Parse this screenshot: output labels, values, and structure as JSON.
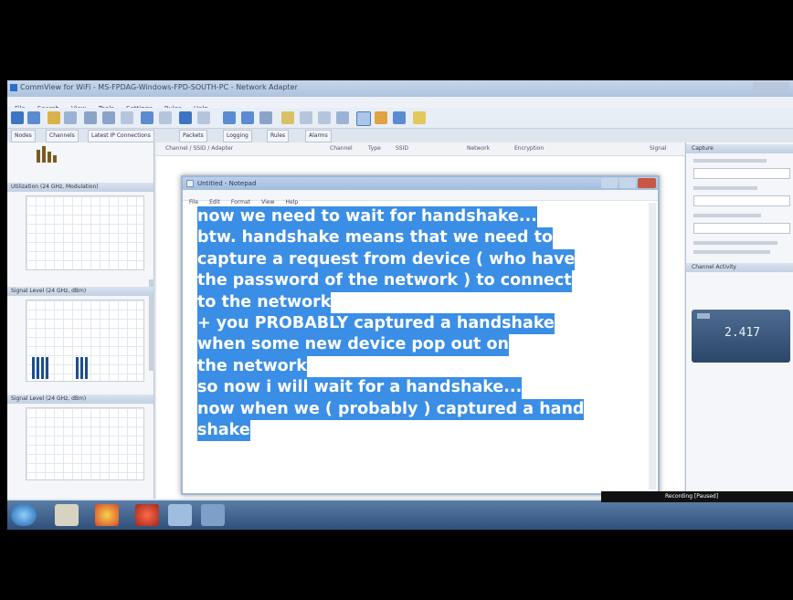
{
  "window": {
    "title": "CommView for WiFi - MS-FPDAG-Windows-FPD-SOUTH-PC - Network Adapter"
  },
  "menu": [
    "File",
    "Search",
    "View",
    "Tools",
    "Settings",
    "Rules",
    "Help"
  ],
  "tabs": [
    "Nodes",
    "Channels",
    "Latest IP Connections",
    "Packets",
    "Logging",
    "Rules",
    "Alarms"
  ],
  "left_panels": [
    {
      "title": "Utilization (24 GHz, Modulation)"
    },
    {
      "title": "Signal Level (24 GHz, dBm)"
    },
    {
      "title": "Signal Level (24 GHz, dBm)"
    }
  ],
  "main_columns": [
    "Channel / SSID / Adapter",
    "Channel",
    "Type",
    "SSID",
    "Network",
    "Encryption",
    "Signal"
  ],
  "right_panel": {
    "capture_header": "Capture",
    "activity_header": "Channel Activity",
    "display_value": "2.417"
  },
  "notepad": {
    "title": "Untitled - Notepad",
    "menu": [
      "File",
      "Edit",
      "Format",
      "View",
      "Help"
    ],
    "lines": [
      "now we need to wait for handshake...",
      "btw. handshake means that we need to",
      "capture a request from device ( who have",
      "the password of the network ) to connect",
      "to the network",
      "+ you PROBABLY captured a handshake",
      "when some new device pop out on",
      "the network",
      "so now i will wait for a handshake...",
      "now when we ( probably ) captured a hand",
      "shake"
    ]
  },
  "recording": {
    "label": "Recording [Paused]"
  },
  "colors": {
    "selection": "#3b8ee6",
    "taskbar": "#2f4f7a",
    "titlebar": "#aec3df"
  }
}
